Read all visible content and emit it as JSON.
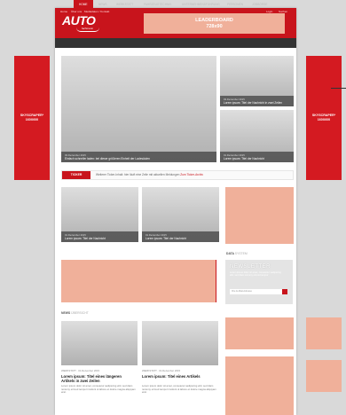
{
  "topbar": {
    "links": [
      "Home",
      "Über uns",
      "Mediadaten / Kontakt"
    ],
    "login": "Login",
    "search": "Suchen"
  },
  "logo": {
    "text": "AUTO",
    "sub": "fachmann"
  },
  "leaderboard": {
    "line1": "LEADERBOARD",
    "line2": "728x90"
  },
  "nav": {
    "items": [
      "HOME",
      "NEWS",
      "WERKSTATT",
      "FAHRZEUGTECHNIK",
      "UNTERNEHMENSFÜHRUNG",
      "PERSONEN",
      "JOBBÖRSE"
    ]
  },
  "skyscraper_left": {
    "line1": "SKYSCRAPER*",
    "line2": "160X600"
  },
  "skyscraper_right": {
    "line1": "SKYSCRAPER*",
    "line2": "160X600"
  },
  "hero": {
    "main": {
      "date": "03.Dezember 2015",
      "title": "Einfach schneller laden: bei dieser größeren Einheit der Ladesäulen"
    },
    "side1": {
      "date": "03.Dezember 2015",
      "title": "Lorem ipsum: Titel der Nachricht in zwei Zeilen"
    },
    "side2": {
      "date": "01.Dezember 2015",
      "title": "Lorem ipsum: Titel der Nachricht"
    }
  },
  "ticker": {
    "label": "TICKER",
    "text": "Weiterer Ticker-Inhalt: hier läuft eine Zeile mit aktuellen Meldungen",
    "link": "Zum Ticker-Archiv"
  },
  "teasers": [
    {
      "date": "01.Dezember 2015",
      "title": "Lorem ipsum: Titel der Nachricht"
    },
    {
      "date": "01.Dezember 2015",
      "title": "Lorem ipsum: Titel der Nachricht"
    }
  ],
  "sidebar": {
    "label_strong": "DATA",
    "label_light": "SYSTEM",
    "newsletter": {
      "title": "NEWSLETTER",
      "text": "Lorem ipsum dolor sit amet, consetetur sadipscing elitr, sed diam nonumy eirmod tempor",
      "placeholder": "Ihre E-Mail-Adresse"
    }
  },
  "news_section": {
    "label_strong": "NEWS",
    "label_light": "ÜBERSICHT"
  },
  "articles": [
    {
      "meta": "WERKSTATT · 01.Dezember 2015",
      "title": "Lorem ipsum: Titel eines längeren Artikels in zwei Zeilen",
      "text": "Lorem ipsum dolor sit amet, consetetur sadipscing elitr, sed diam nonumy eirmod tempor invidunt ut labore et dolore magna aliquyam erat."
    },
    {
      "meta": "WERKSTATT · 01.Dezember 2015",
      "title": "Lorem ipsum: Titel eines Artikels",
      "text": "Lorem ipsum dolor sit amet, consetetur sadipscing elitr, sed diam nonumy eirmod tempor invidunt ut labore et dolore magna aliquyam erat."
    }
  ],
  "colors": {
    "brand_red": "#c8141c",
    "ad_placeholder": "#f0b09a",
    "skyscraper": "#d41a21",
    "nav": "#333333"
  }
}
